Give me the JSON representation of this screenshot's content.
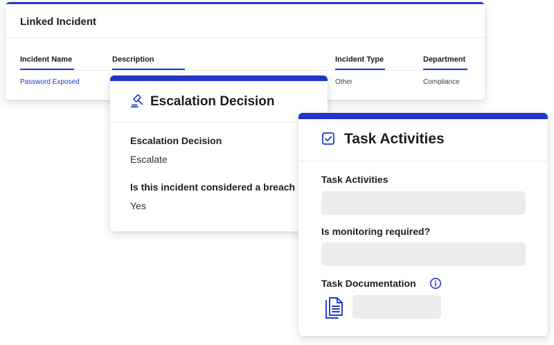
{
  "linked_incident": {
    "title": "Linked Incident",
    "columns": [
      "Incident Name",
      "Description",
      "Incident Type",
      "Department"
    ],
    "row": {
      "incident_name": "Password Exposed",
      "description": "",
      "incident_type": "Other",
      "department": "Compliance"
    }
  },
  "escalation": {
    "icon": "gavel-icon",
    "title": "Escalation Decision",
    "fields": [
      {
        "label": "Escalation Decision",
        "value": "Escalate"
      },
      {
        "label": "Is this incident considered a breach",
        "value": "Yes"
      }
    ]
  },
  "task": {
    "icon": "checkbox-icon",
    "title": "Task Activities",
    "fields": [
      {
        "label": "Task Activities",
        "value": ""
      },
      {
        "label": "Is monitoring required?",
        "value": ""
      },
      {
        "label": "Task Documentation",
        "value": ""
      }
    ],
    "info_icon": "info-icon",
    "doc_icon": "document-icon"
  },
  "colors": {
    "accent": "#1f36c7",
    "field_bg": "#ececec",
    "text": "#1a1c22"
  }
}
